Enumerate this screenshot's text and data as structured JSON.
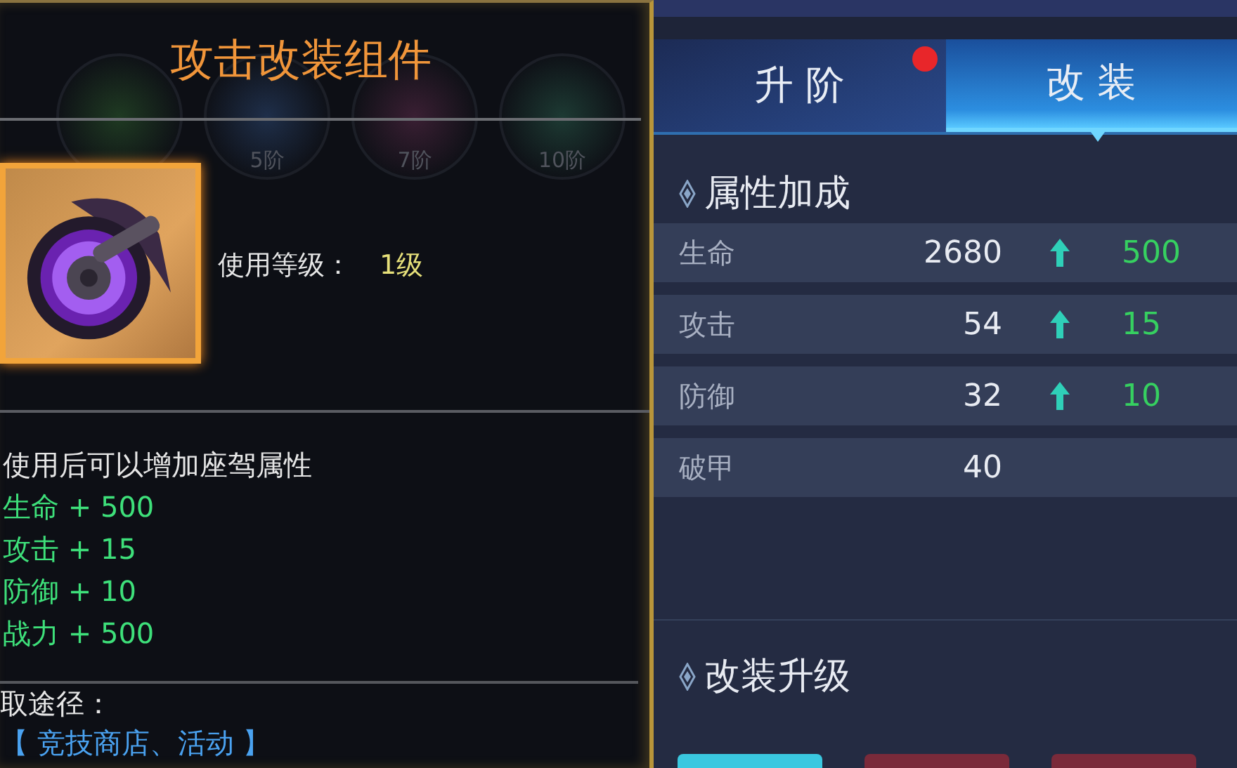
{
  "item_panel": {
    "title": "攻击改装组件",
    "stage_icons": [
      {
        "color": "#1f3a22"
      },
      {
        "label": "5阶",
        "color": "#1f2f4a"
      },
      {
        "label": "7阶",
        "color": "#3a1f33"
      },
      {
        "label": "10阶",
        "color": "#1d3a33"
      }
    ],
    "item": {
      "level_label": "使用等级：",
      "level_value": "1级"
    },
    "description": "使用后可以增加座驾属性",
    "effects": [
      "生命 + 500",
      "攻击 + 15",
      "防御 + 10",
      "战力 + 500"
    ],
    "source_label": "取途径：",
    "source": "【 竞技商店、活动 】"
  },
  "upgrade_panel": {
    "tabs": [
      {
        "label": "升 阶",
        "selected": false,
        "badge": true
      },
      {
        "label": "改 装",
        "selected": true,
        "badge": false
      }
    ],
    "attributes": {
      "heading": "属性加成",
      "rows": [
        {
          "name": "生命",
          "value": "2680",
          "bonus": "500"
        },
        {
          "name": "攻击",
          "value": "54",
          "bonus": "15"
        },
        {
          "name": "防御",
          "value": "32",
          "bonus": "10"
        },
        {
          "name": "破甲",
          "value": "40"
        }
      ]
    },
    "upgrade": {
      "heading": "改装升级"
    }
  }
}
